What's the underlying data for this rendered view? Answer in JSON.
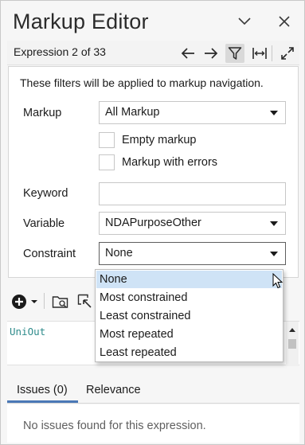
{
  "window": {
    "title": "Markup Editor",
    "colors": {
      "accent": "#4a78b6",
      "selection": "#cfe3f6",
      "code_text": "#2e8b8b",
      "add_icon": "#1b1b1b"
    }
  },
  "toolbar": {
    "expression_label": "Expression 2 of 33",
    "icons": [
      "arrow-left-icon",
      "arrow-right-icon",
      "filter-icon",
      "fit-width-icon",
      "expand-icon"
    ]
  },
  "filter": {
    "description": "These filters will be applied to markup navigation.",
    "markup": {
      "label": "Markup",
      "value": "All Markup"
    },
    "empty_markup": {
      "label": "Empty markup",
      "checked": false
    },
    "markup_errors": {
      "label": "Markup with errors",
      "checked": false
    },
    "keyword": {
      "label": "Keyword",
      "value": ""
    },
    "variable": {
      "label": "Variable",
      "value": "NDAPurposeOther"
    },
    "constraint": {
      "label": "Constraint",
      "value": "None"
    }
  },
  "constraint_options": [
    "None",
    "Most constrained",
    "Least constrained",
    "Most repeated",
    "Least repeated"
  ],
  "constraint_selected_index": 0,
  "editor": {
    "code": "UniOut"
  },
  "tabs": [
    {
      "label": "Issues (0)",
      "active": true
    },
    {
      "label": "Relevance",
      "active": false
    }
  ],
  "issues": {
    "message": "No issues found for this expression."
  }
}
